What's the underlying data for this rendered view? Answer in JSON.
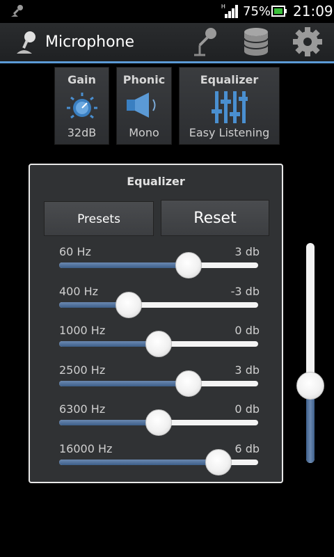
{
  "status_bar": {
    "notification_icon": "microphone-notification-icon",
    "network_label": "H",
    "battery_percent": "75%",
    "clock": "21:09",
    "accent_color": "#3bbf3b"
  },
  "action_bar": {
    "title": "Microphone",
    "icons": [
      "microphone-icon",
      "microphone-stand-icon",
      "database-icon",
      "gear-icon"
    ],
    "accent_color": "#5b9ad6"
  },
  "tabs": [
    {
      "title": "Gain",
      "value": "32dB",
      "icon": "gain-knob-icon"
    },
    {
      "title": "Phonic",
      "value": "Mono",
      "icon": "speaker-icon"
    },
    {
      "title": "Equalizer",
      "value": "Easy Listening",
      "icon": "equalizer-sliders-icon"
    }
  ],
  "equalizer": {
    "title": "Equalizer",
    "presets_label": "Presets",
    "reset_label": "Reset",
    "range_db": [
      -10,
      10
    ],
    "bands": [
      {
        "freq": "60 Hz",
        "gain": "3 db",
        "value": 3
      },
      {
        "freq": "400 Hz",
        "gain": "-3 db",
        "value": -3
      },
      {
        "freq": "1000 Hz",
        "gain": "0 db",
        "value": 0
      },
      {
        "freq": "2500 Hz",
        "gain": "3 db",
        "value": 3
      },
      {
        "freq": "6300 Hz",
        "gain": "0 db",
        "value": 0
      },
      {
        "freq": "16000 Hz",
        "gain": "6 db",
        "value": 6
      }
    ],
    "fill_color": "#4f7099"
  },
  "volume": {
    "level": 0.35
  }
}
